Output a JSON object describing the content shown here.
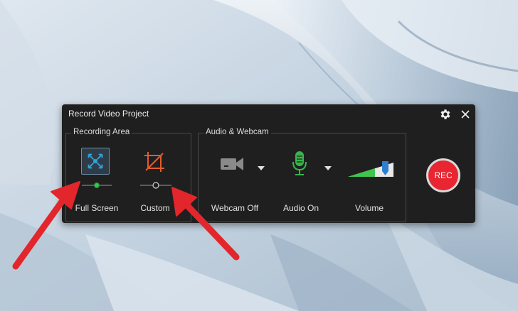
{
  "dialog": {
    "title": "Record Video Project"
  },
  "recording_area": {
    "group_label": "Recording Area",
    "full_screen_label": "Full Screen",
    "custom_label": "Custom",
    "full_screen_selected": true
  },
  "audio_webcam": {
    "group_label": "Audio & Webcam",
    "webcam_label": "Webcam Off",
    "audio_label": "Audio On",
    "volume_label": "Volume",
    "volume_level": 0.85
  },
  "rec_button": {
    "label": "REC"
  },
  "colors": {
    "dialog_bg": "#1f1f1f",
    "accent_blue": "#2fa3dc",
    "crop_orange": "#e55b2d",
    "mic_green": "#37b54a",
    "rec_red": "#e82531",
    "annotation_red": "#e2262c"
  },
  "icons": {
    "settings": "gear-icon",
    "close": "close-icon",
    "full_screen": "expand-arrows-icon",
    "custom": "crop-icon",
    "webcam": "video-camera-icon",
    "audio": "microphone-icon",
    "volume": "volume-ramp-icon"
  }
}
